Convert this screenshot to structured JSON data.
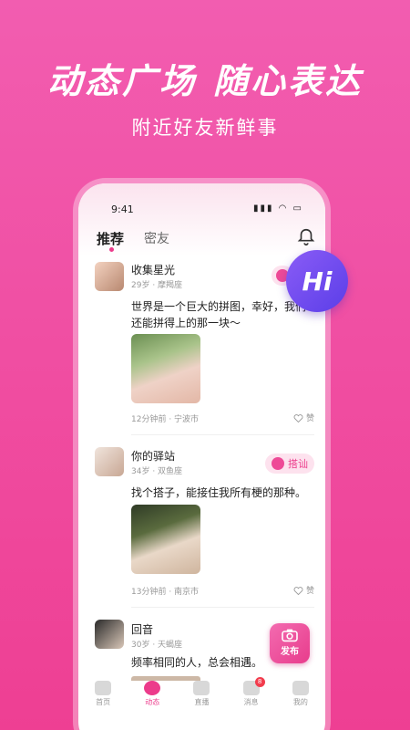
{
  "headline": [
    "动态广场",
    "随心表达"
  ],
  "subline": "附近好友新鲜事",
  "status": {
    "time": "9:41",
    "icons": "▮▮▮ ◠ ▭"
  },
  "tabs": {
    "recommend": "推荐",
    "friends": "密友"
  },
  "posts": [
    {
      "name": "收集星光",
      "meta": "29岁 · 摩羯座",
      "text": "世界是一个巨大的拼图，幸好，我们还能拼得上的那一块～",
      "time": "12分钟前 · 宁波市",
      "like": "赞",
      "chat": ""
    },
    {
      "name": "你的驿站",
      "meta": "34岁 · 双鱼座",
      "text": "找个搭子，能接住我所有梗的那种。",
      "time": "13分钟前 · 南京市",
      "like": "赞",
      "chat": "搭讪"
    },
    {
      "name": "回音",
      "meta": "30岁 · 天蝎座",
      "text": "频率相同的人，总会相遇。",
      "time": "",
      "like": "",
      "chat": ""
    }
  ],
  "nav": [
    {
      "label": "首页"
    },
    {
      "label": "动态"
    },
    {
      "label": "直播"
    },
    {
      "label": "消息",
      "badge": "8"
    },
    {
      "label": "我的"
    }
  ],
  "publish": "发布",
  "hi": "Hi",
  "colors": {
    "accent": "#ec3b8b",
    "hi_bubble": "#6f4cf0"
  }
}
